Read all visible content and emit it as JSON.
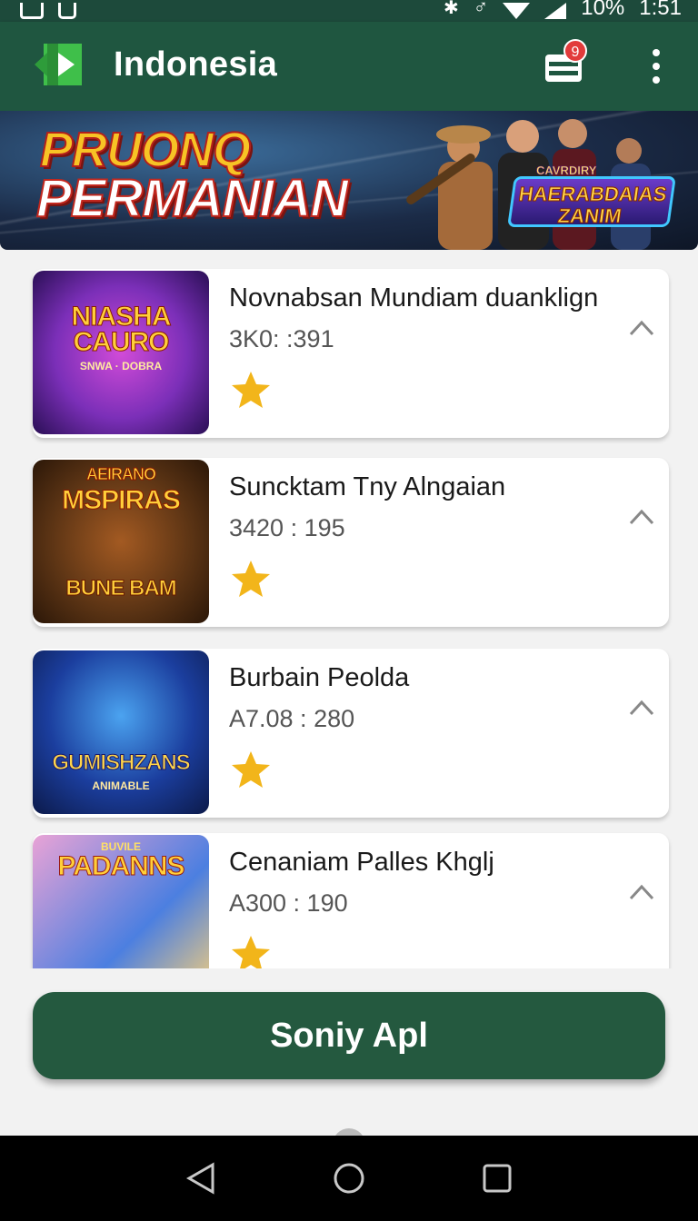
{
  "status_bar": {
    "battery": "10%",
    "time": "1:51"
  },
  "app_bar": {
    "title": "Indonesia",
    "cart_badge": "9"
  },
  "banner": {
    "title_line1": "PRUONQ",
    "title_line2": "PERMANIAN",
    "badge_small": "CAVRDIRY",
    "badge_line1": "HAERABDAIAS",
    "badge_line2": "ZANIM"
  },
  "apps": [
    {
      "title": "Novnabsan Mundiam duanklign",
      "meta": "3K0: :391",
      "thumb_line1": "NIASHA",
      "thumb_line2": "CAURO",
      "thumb_sub": "SNWA · DOBRA",
      "colors": [
        "#7b2fb8",
        "#d14bd8",
        "#2a0f55"
      ]
    },
    {
      "title": "Sunck­tam  Tny Alngaian",
      "meta": "3420 : 195",
      "thumb_line1": "AEIRANO",
      "thumb_line2": "MSPIRAS",
      "thumb_sub": "BUNE BAM",
      "colors": [
        "#5a3314",
        "#a35a22",
        "#2b1708"
      ]
    },
    {
      "title": "Burbain Peolda",
      "meta": "A7.08 : 280",
      "thumb_line1": "",
      "thumb_line2": "GUMISHZANS",
      "thumb_sub": "ANIMABLE",
      "colors": [
        "#1b3e9e",
        "#4ba3f0",
        "#0c1a4a"
      ]
    },
    {
      "title": "Cenaniam Palles Khglj",
      "meta": "A300 : 190",
      "thumb_line1": "BUVILE",
      "thumb_line2": "PADANNS",
      "thumb_sub": "",
      "colors": [
        "#e9a3d6",
        "#4c7fe0",
        "#f7d07a"
      ]
    }
  ],
  "primary_button": {
    "label": "Soniy  Apl"
  },
  "accent_color": "#1f5640"
}
